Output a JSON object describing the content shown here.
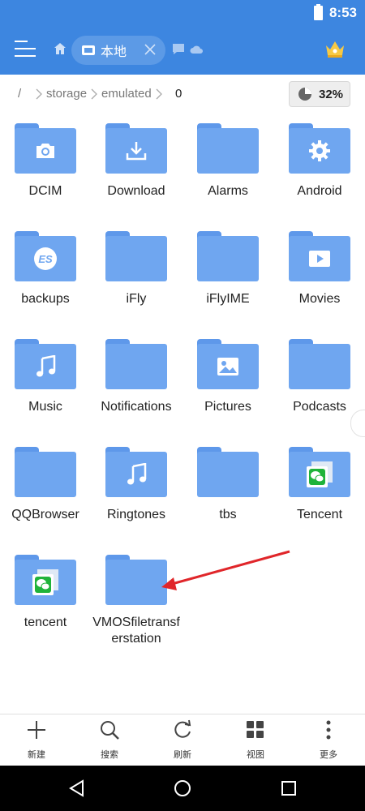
{
  "status": {
    "time": "8:53"
  },
  "toolbar": {
    "tab_label": "本地"
  },
  "path": {
    "root": "/",
    "crumbs": [
      "storage",
      "emulated"
    ],
    "current": "0",
    "storage_percent": "32%"
  },
  "folders": [
    {
      "name": "DCIM",
      "icon": "camera-icon"
    },
    {
      "name": "Download",
      "icon": "download-icon"
    },
    {
      "name": "Alarms",
      "icon": ""
    },
    {
      "name": "Android",
      "icon": "gear-icon"
    },
    {
      "name": "backups",
      "icon": "es-logo-icon"
    },
    {
      "name": "iFly",
      "icon": ""
    },
    {
      "name": "iFlyIME",
      "icon": ""
    },
    {
      "name": "Movies",
      "icon": "play-icon"
    },
    {
      "name": "Music",
      "icon": "music-note-icon"
    },
    {
      "name": "Notifications",
      "icon": ""
    },
    {
      "name": "Pictures",
      "icon": "image-icon"
    },
    {
      "name": "Podcasts",
      "icon": ""
    },
    {
      "name": "QQBrowser",
      "icon": ""
    },
    {
      "name": "Ringtones",
      "icon": "music-note-icon"
    },
    {
      "name": "tbs",
      "icon": ""
    },
    {
      "name": "Tencent",
      "icon": "wechat-icon"
    },
    {
      "name": "tencent",
      "icon": "wechat-icon"
    },
    {
      "name": "VMOSfiletransferstation",
      "icon": ""
    }
  ],
  "bottom_bar": {
    "new": "新建",
    "search": "搜索",
    "refresh": "刷新",
    "view": "视图",
    "more": "更多"
  },
  "colors": {
    "accent": "#3d86e0",
    "folder": "#6fa6f0",
    "arrow": "#e0262a"
  }
}
